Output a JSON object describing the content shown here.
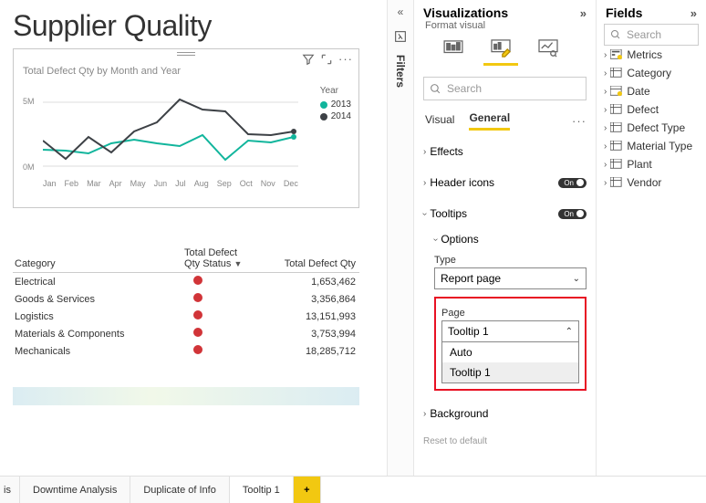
{
  "title": "Supplier Quality",
  "chart_data": {
    "type": "line",
    "title": "Total Defect Qty by Month and Year",
    "xlabel": "",
    "ylabel": "",
    "categories": [
      "Jan",
      "Feb",
      "Mar",
      "Apr",
      "May",
      "Jun",
      "Jul",
      "Aug",
      "Sep",
      "Oct",
      "Nov",
      "Dec"
    ],
    "yticks": [
      "5M",
      "0M"
    ],
    "ylim": [
      0,
      6000000
    ],
    "legend_title": "Year",
    "series": [
      {
        "name": "2013",
        "color": "#11b59c",
        "values": [
          1300000,
          1200000,
          1000000,
          1800000,
          2100000,
          1800000,
          1600000,
          2400000,
          500000,
          1900000,
          1800000,
          2200000
        ]
      },
      {
        "name": "2014",
        "color": "#3d4146",
        "values": [
          2000000,
          600000,
          2300000,
          1100000,
          2700000,
          3400000,
          5200000,
          4400000,
          4200000,
          2500000,
          2400000,
          2700000
        ]
      }
    ]
  },
  "table": {
    "columns": [
      "Category",
      "Total Defect Qty Status",
      "Total Defect Qty"
    ],
    "rows": [
      {
        "category": "Electrical",
        "qty": "1,653,462"
      },
      {
        "category": "Goods & Services",
        "qty": "3,356,864"
      },
      {
        "category": "Logistics",
        "qty": "13,151,993"
      },
      {
        "category": "Materials & Components",
        "qty": "3,753,994"
      },
      {
        "category": "Mechanicals",
        "qty": "18,285,712"
      }
    ]
  },
  "page_tabs": {
    "partial": "is",
    "items": [
      "Downtime Analysis",
      "Duplicate of Info",
      "Tooltip 1"
    ],
    "add": "+"
  },
  "filters_label": "Filters",
  "viz": {
    "header": "Visualizations",
    "format_label": "Format visual",
    "search_placeholder": "Search",
    "subtabs": {
      "visual": "Visual",
      "general": "General"
    },
    "sections": {
      "effects": "Effects",
      "header_icons": "Header icons",
      "tooltips": "Tooltips",
      "options": "Options",
      "background": "Background"
    },
    "toggle_on": "On",
    "type_label": "Type",
    "type_value": "Report page",
    "page_label": "Page",
    "page_value": "Tooltip 1",
    "page_options": [
      "Auto",
      "Tooltip 1"
    ],
    "reset": "Reset to default"
  },
  "fields": {
    "header": "Fields",
    "search_placeholder": "Search",
    "items": [
      {
        "name": "Metrics",
        "icon": "measure"
      },
      {
        "name": "Category",
        "icon": "table"
      },
      {
        "name": "Date",
        "icon": "date"
      },
      {
        "name": "Defect",
        "icon": "table"
      },
      {
        "name": "Defect Type",
        "icon": "table"
      },
      {
        "name": "Material Type",
        "icon": "table"
      },
      {
        "name": "Plant",
        "icon": "table"
      },
      {
        "name": "Vendor",
        "icon": "table"
      }
    ]
  }
}
